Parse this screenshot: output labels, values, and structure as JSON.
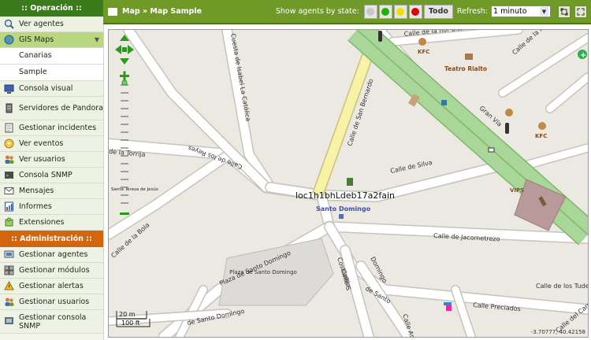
{
  "sidebar": {
    "operation_header": ":: Operación ::",
    "admin_header": ":: Administración ::",
    "operation_items": [
      {
        "label": "Ver agentes"
      },
      {
        "label": "GIS Maps"
      },
      {
        "label": "Consola visual"
      },
      {
        "label": "Servidores de Pandora"
      },
      {
        "label": "Gestionar incidentes"
      },
      {
        "label": "Ver eventos"
      },
      {
        "label": "Ver usuarios"
      },
      {
        "label": "Consola SNMP"
      },
      {
        "label": "Mensajes"
      },
      {
        "label": "Informes"
      },
      {
        "label": "Extensiones"
      }
    ],
    "gis_sub": [
      "Canarias",
      "Sample"
    ],
    "admin_items": [
      {
        "label": "Gestionar agentes"
      },
      {
        "label": "Gestionar módulos"
      },
      {
        "label": "Gestionar alertas"
      },
      {
        "label": "Gestionar usuarios"
      },
      {
        "label": "Gestionar consola SNMP"
      }
    ]
  },
  "toolbar": {
    "breadcrumb": "Map » Map Sample",
    "agents_label": "Show agents by state:",
    "state_colors": [
      "#c8c8c8",
      "#22b000",
      "#f0e000",
      "#e00000"
    ],
    "todo_label": "Todo",
    "refresh_label": "Refresh:",
    "refresh_value": "1 minuto"
  },
  "map": {
    "streets": {
      "cuesta": "Cuesta de Isabel La Católica",
      "flor_alta": "Calle de la flor alta",
      "flor_baja": "Calle de la Flor Baja",
      "san_bernardo": "Calle de San Bernardo",
      "gran_via": "Gran Vía",
      "silva": "Calle de Silva",
      "torrija": "de la Torrija",
      "bola": "Calle de la Bola",
      "reyes": "Calle de los Reyes",
      "jacometrezo": "Calle de Jacometrezo",
      "plaza_sd": "Plaza de Santo Domingo",
      "calle_sd": "de Santo Domingo",
      "preciados": "Calle Preciados",
      "carmen": "Calle del Carmen",
      "tudescos": "Calle de los Tudescos",
      "costanilla": "Costanilla",
      "ana_s": "Calle Ana S",
      "calle_s": "Calle S",
      "domingo": "Domingo",
      "de_santo": "de Santo"
    },
    "pois": {
      "kfc": "KFC",
      "teatro": "Teatro Rialto",
      "vips": "VIPS",
      "santa_teresa": "Santa Teresa de Jesús",
      "santo_domingo": "Santo Domingo",
      "plaza_label": "Plaza de Santo Domingo"
    },
    "agent_overlap_label": "loc1h1bhLdeb17a2fain",
    "scale_m": "20 m",
    "scale_ft": "100 ft",
    "coords": "-3.70777, 40.42158"
  }
}
